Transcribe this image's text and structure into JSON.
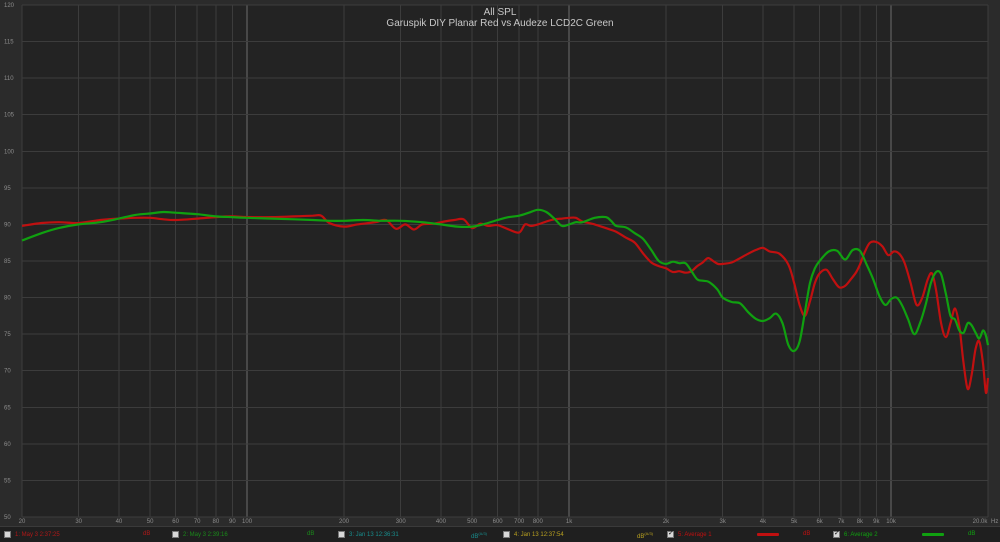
{
  "chart_data": {
    "type": "line",
    "title": "All SPL",
    "subtitle": "Garuspik DIY Planar Red vs Audeze LCD2C Green",
    "x_scale": "log",
    "xlim": [
      20,
      20000
    ],
    "ylim": [
      50,
      120
    ],
    "x_unit_label": "Hz",
    "grid": true,
    "x_ticks": [
      {
        "v": 20,
        "label": "20"
      },
      {
        "v": 30,
        "label": "30"
      },
      {
        "v": 40,
        "label": "40"
      },
      {
        "v": 50,
        "label": "50"
      },
      {
        "v": 60,
        "label": "60"
      },
      {
        "v": 70,
        "label": "70"
      },
      {
        "v": 80,
        "label": "80"
      },
      {
        "v": 90,
        "label": "90"
      },
      {
        "v": 100,
        "label": "100"
      },
      {
        "v": 200,
        "label": "200"
      },
      {
        "v": 300,
        "label": "300"
      },
      {
        "v": 400,
        "label": "400"
      },
      {
        "v": 500,
        "label": "500"
      },
      {
        "v": 600,
        "label": "600"
      },
      {
        "v": 700,
        "label": "700"
      },
      {
        "v": 800,
        "label": "800"
      },
      {
        "v": 1000,
        "label": "1k"
      },
      {
        "v": 2000,
        "label": "2k"
      },
      {
        "v": 3000,
        "label": "3k"
      },
      {
        "v": 4000,
        "label": "4k"
      },
      {
        "v": 5000,
        "label": "5k"
      },
      {
        "v": 6000,
        "label": "6k"
      },
      {
        "v": 7000,
        "label": "7k"
      },
      {
        "v": 8000,
        "label": "8k"
      },
      {
        "v": 9000,
        "label": "9k"
      },
      {
        "v": 10000,
        "label": "10k"
      },
      {
        "v": 20000,
        "label": "20.0k"
      }
    ],
    "major_x": [
      100,
      1000,
      10000
    ],
    "y_ticks": [
      {
        "v": 120,
        "label": "120"
      },
      {
        "v": 115,
        "label": "115"
      },
      {
        "v": 110,
        "label": "110"
      },
      {
        "v": 105,
        "label": "105"
      },
      {
        "v": 100,
        "label": "100"
      },
      {
        "v": 95,
        "label": "95"
      },
      {
        "v": 90,
        "label": "90"
      },
      {
        "v": 85,
        "label": "85"
      },
      {
        "v": 80,
        "label": "80"
      },
      {
        "v": 75,
        "label": "75"
      },
      {
        "v": 70,
        "label": "70"
      },
      {
        "v": 65,
        "label": "65"
      },
      {
        "v": 60,
        "label": "60"
      },
      {
        "v": 55,
        "label": "55"
      },
      {
        "v": 50,
        "label": "50"
      }
    ],
    "series": [
      {
        "name": "Average 1",
        "color": "#c01010",
        "points": [
          [
            20,
            89.8
          ],
          [
            23,
            90.2
          ],
          [
            26,
            90.3
          ],
          [
            30,
            90.2
          ],
          [
            35,
            90.6
          ],
          [
            40,
            90.8
          ],
          [
            45,
            90.9
          ],
          [
            50,
            90.9
          ],
          [
            55,
            90.7
          ],
          [
            60,
            90.6
          ],
          [
            70,
            90.8
          ],
          [
            80,
            91.0
          ],
          [
            90,
            91.1
          ],
          [
            100,
            91.0
          ],
          [
            120,
            91.0
          ],
          [
            140,
            91.1
          ],
          [
            160,
            91.2
          ],
          [
            170,
            91.2
          ],
          [
            180,
            90.2
          ],
          [
            200,
            89.7
          ],
          [
            220,
            90.0
          ],
          [
            250,
            90.3
          ],
          [
            270,
            90.6
          ],
          [
            290,
            89.4
          ],
          [
            310,
            90.0
          ],
          [
            330,
            89.3
          ],
          [
            350,
            90.0
          ],
          [
            380,
            90.1
          ],
          [
            410,
            90.4
          ],
          [
            440,
            90.6
          ],
          [
            470,
            90.7
          ],
          [
            500,
            89.5
          ],
          [
            530,
            90.1
          ],
          [
            560,
            89.8
          ],
          [
            600,
            89.9
          ],
          [
            650,
            89.3
          ],
          [
            700,
            88.9
          ],
          [
            730,
            90.0
          ],
          [
            760,
            89.8
          ],
          [
            800,
            90.0
          ],
          [
            850,
            90.4
          ],
          [
            900,
            90.7
          ],
          [
            950,
            90.8
          ],
          [
            1000,
            90.9
          ],
          [
            1050,
            90.9
          ],
          [
            1100,
            90.4
          ],
          [
            1200,
            90.0
          ],
          [
            1300,
            89.5
          ],
          [
            1400,
            89.0
          ],
          [
            1500,
            88.2
          ],
          [
            1600,
            87.5
          ],
          [
            1700,
            86.0
          ],
          [
            1800,
            84.8
          ],
          [
            1900,
            84.3
          ],
          [
            2000,
            84.0
          ],
          [
            2100,
            83.5
          ],
          [
            2200,
            83.6
          ],
          [
            2300,
            83.4
          ],
          [
            2400,
            83.6
          ],
          [
            2500,
            84.3
          ],
          [
            2600,
            84.8
          ],
          [
            2700,
            85.4
          ],
          [
            2800,
            85.0
          ],
          [
            2900,
            84.6
          ],
          [
            3000,
            84.6
          ],
          [
            3200,
            84.8
          ],
          [
            3400,
            85.4
          ],
          [
            3600,
            86.0
          ],
          [
            3800,
            86.5
          ],
          [
            4000,
            86.8
          ],
          [
            4200,
            86.3
          ],
          [
            4500,
            86.0
          ],
          [
            4800,
            84.5
          ],
          [
            5000,
            82.0
          ],
          [
            5200,
            79.0
          ],
          [
            5400,
            77.5
          ],
          [
            5600,
            79.5
          ],
          [
            5800,
            82.0
          ],
          [
            6000,
            83.3
          ],
          [
            6300,
            83.8
          ],
          [
            6600,
            82.5
          ],
          [
            6900,
            81.4
          ],
          [
            7200,
            81.6
          ],
          [
            7500,
            82.5
          ],
          [
            7800,
            83.5
          ],
          [
            8000,
            84.5
          ],
          [
            8300,
            86.3
          ],
          [
            8600,
            87.5
          ],
          [
            9000,
            87.6
          ],
          [
            9400,
            87.0
          ],
          [
            9800,
            85.8
          ],
          [
            10200,
            86.3
          ],
          [
            10600,
            86.0
          ],
          [
            11000,
            84.8
          ],
          [
            11500,
            82.0
          ],
          [
            12000,
            79.0
          ],
          [
            12500,
            80.0
          ],
          [
            13000,
            82.5
          ],
          [
            13400,
            83.3
          ],
          [
            13800,
            81.0
          ],
          [
            14300,
            76.5
          ],
          [
            14800,
            74.6
          ],
          [
            15300,
            76.5
          ],
          [
            15800,
            78.5
          ],
          [
            16300,
            76.0
          ],
          [
            16800,
            71.0
          ],
          [
            17300,
            67.5
          ],
          [
            17800,
            69.5
          ],
          [
            18300,
            73.0
          ],
          [
            18800,
            74.0
          ],
          [
            19300,
            71.0
          ],
          [
            19700,
            67.0
          ],
          [
            20000,
            69.0
          ]
        ]
      },
      {
        "name": "Average 2",
        "color": "#10a010",
        "points": [
          [
            20,
            87.8
          ],
          [
            23,
            88.8
          ],
          [
            26,
            89.5
          ],
          [
            30,
            90.0
          ],
          [
            35,
            90.3
          ],
          [
            40,
            90.8
          ],
          [
            45,
            91.3
          ],
          [
            50,
            91.5
          ],
          [
            55,
            91.7
          ],
          [
            60,
            91.6
          ],
          [
            70,
            91.4
          ],
          [
            80,
            91.1
          ],
          [
            90,
            91.0
          ],
          [
            100,
            90.9
          ],
          [
            120,
            90.8
          ],
          [
            140,
            90.7
          ],
          [
            160,
            90.6
          ],
          [
            180,
            90.5
          ],
          [
            200,
            90.5
          ],
          [
            230,
            90.6
          ],
          [
            260,
            90.5
          ],
          [
            300,
            90.5
          ],
          [
            350,
            90.3
          ],
          [
            400,
            90.0
          ],
          [
            450,
            89.7
          ],
          [
            500,
            89.7
          ],
          [
            550,
            90.1
          ],
          [
            600,
            90.6
          ],
          [
            650,
            91.0
          ],
          [
            700,
            91.2
          ],
          [
            750,
            91.6
          ],
          [
            800,
            92.0
          ],
          [
            850,
            91.7
          ],
          [
            900,
            90.8
          ],
          [
            950,
            89.8
          ],
          [
            1000,
            90.0
          ],
          [
            1050,
            90.3
          ],
          [
            1100,
            90.3
          ],
          [
            1200,
            90.9
          ],
          [
            1300,
            91.0
          ],
          [
            1350,
            90.5
          ],
          [
            1400,
            89.8
          ],
          [
            1500,
            89.6
          ],
          [
            1600,
            88.8
          ],
          [
            1700,
            88.0
          ],
          [
            1800,
            86.5
          ],
          [
            1900,
            85.0
          ],
          [
            2000,
            84.6
          ],
          [
            2100,
            84.9
          ],
          [
            2200,
            84.7
          ],
          [
            2300,
            84.7
          ],
          [
            2400,
            83.6
          ],
          [
            2500,
            82.5
          ],
          [
            2600,
            82.3
          ],
          [
            2700,
            82.2
          ],
          [
            2800,
            81.7
          ],
          [
            2900,
            81.0
          ],
          [
            3000,
            80.0
          ],
          [
            3200,
            79.4
          ],
          [
            3400,
            79.2
          ],
          [
            3600,
            78.0
          ],
          [
            3800,
            77.1
          ],
          [
            4000,
            76.8
          ],
          [
            4200,
            77.2
          ],
          [
            4400,
            77.8
          ],
          [
            4600,
            76.5
          ],
          [
            4800,
            73.5
          ],
          [
            5000,
            72.7
          ],
          [
            5200,
            74.0
          ],
          [
            5400,
            78.0
          ],
          [
            5600,
            82.0
          ],
          [
            5800,
            84.0
          ],
          [
            6000,
            85.0
          ],
          [
            6400,
            86.3
          ],
          [
            6800,
            86.4
          ],
          [
            7200,
            85.2
          ],
          [
            7600,
            86.5
          ],
          [
            8000,
            86.4
          ],
          [
            8400,
            84.5
          ],
          [
            8800,
            82.5
          ],
          [
            9200,
            80.2
          ],
          [
            9600,
            79.0
          ],
          [
            10000,
            79.8
          ],
          [
            10400,
            80.0
          ],
          [
            10800,
            79.0
          ],
          [
            11300,
            77.0
          ],
          [
            11800,
            75.0
          ],
          [
            12300,
            76.5
          ],
          [
            12800,
            79.0
          ],
          [
            13300,
            82.0
          ],
          [
            13800,
            83.5
          ],
          [
            14300,
            83.2
          ],
          [
            14800,
            80.5
          ],
          [
            15300,
            77.5
          ],
          [
            15800,
            77.0
          ],
          [
            16300,
            75.5
          ],
          [
            16800,
            75.2
          ],
          [
            17300,
            76.5
          ],
          [
            17800,
            76.2
          ],
          [
            18300,
            75.2
          ],
          [
            18800,
            74.4
          ],
          [
            19300,
            75.5
          ],
          [
            19700,
            74.8
          ],
          [
            20000,
            73.5
          ]
        ]
      }
    ]
  },
  "legend": [
    {
      "label": "1: May 3 2:37:25",
      "unit": "dB",
      "checked": false,
      "color": "#b01818"
    },
    {
      "label": "2: May 3 2:39:16",
      "unit": "dB",
      "checked": false,
      "color": "#1a8a1a"
    },
    {
      "label": "3: Jan 13 12:36:31",
      "unit": "dB",
      "unit_sup": "(A/3)",
      "checked": false,
      "color": "#188c8c"
    },
    {
      "label": "4: Jan 13 12:37:54",
      "unit": "dB",
      "unit_sup": "(A/3)",
      "checked": false,
      "color": "#b8a020"
    },
    {
      "label": "5: Average 1",
      "unit": "dB",
      "checked": true,
      "color": "#c01010"
    },
    {
      "label": "6: Average 2",
      "unit": "dB",
      "checked": true,
      "color": "#10a010"
    }
  ]
}
